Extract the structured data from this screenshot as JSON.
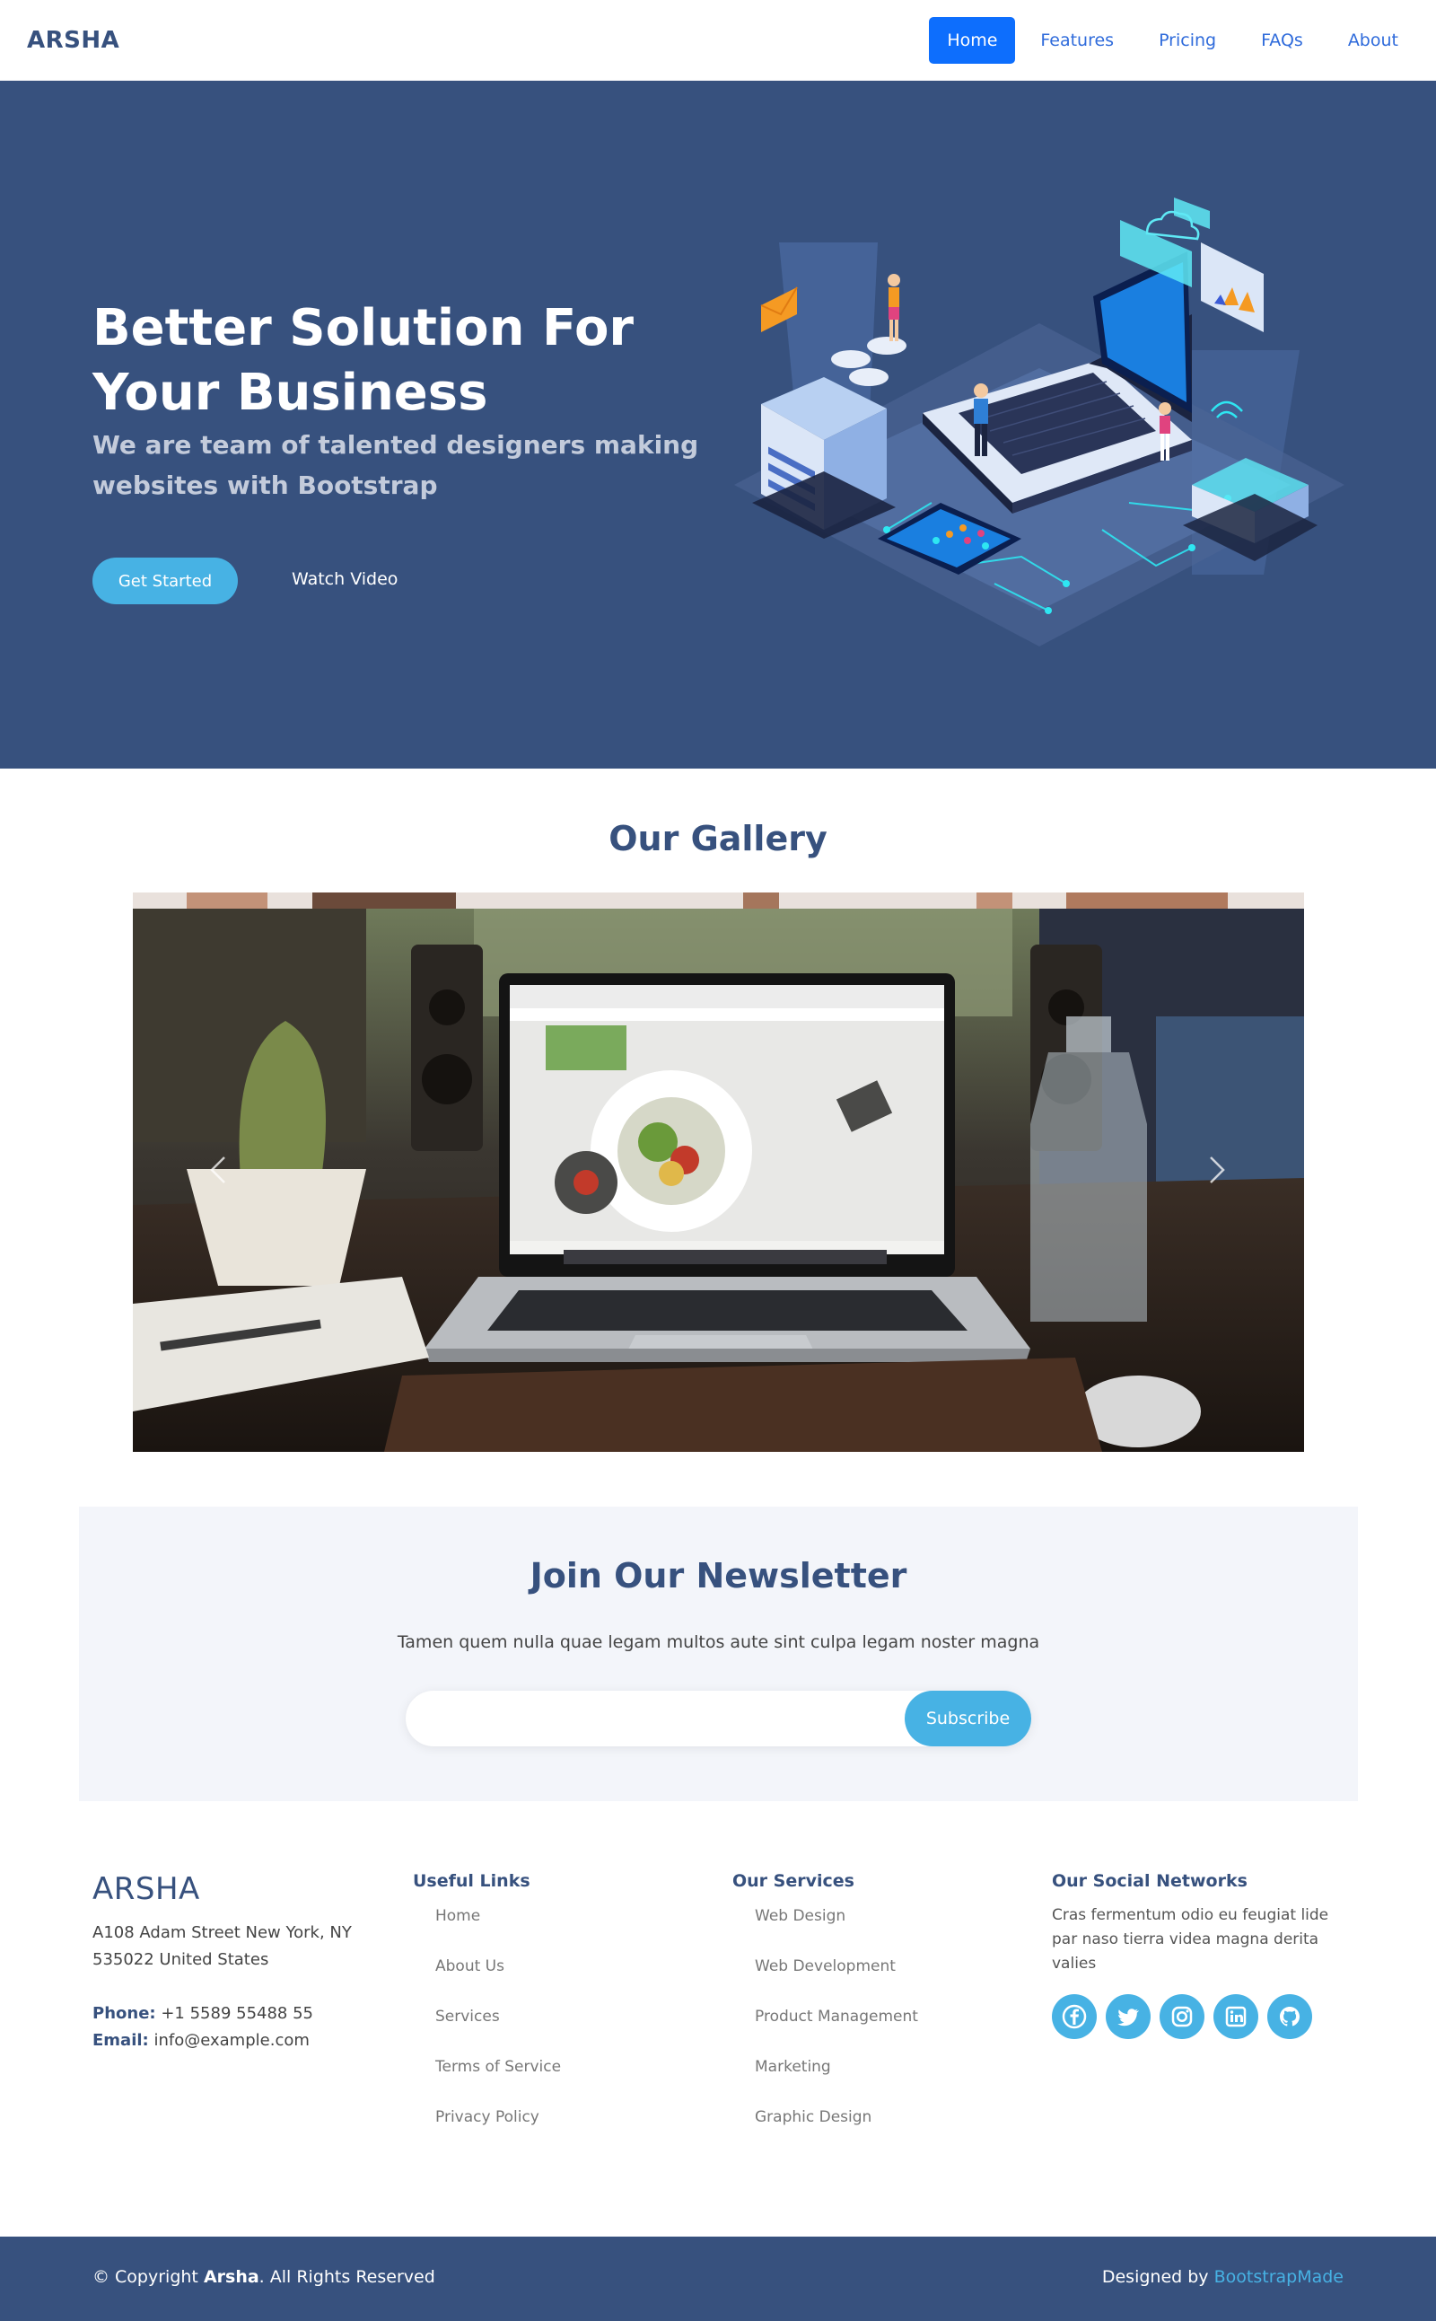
{
  "navbar": {
    "brand": "ARSHA",
    "items": [
      {
        "label": "Home",
        "active": true
      },
      {
        "label": "Features",
        "active": false
      },
      {
        "label": "Pricing",
        "active": false
      },
      {
        "label": "FAQs",
        "active": false
      },
      {
        "label": "About",
        "active": false
      }
    ]
  },
  "hero": {
    "title": "Better Solution For Your Business",
    "subtitle": "We are team of talented designers making websites with Bootstrap",
    "cta_label": "Get Started",
    "video_label": "Watch Video"
  },
  "gallery": {
    "title": "Our Gallery"
  },
  "newsletter": {
    "title": "Join Our Newsletter",
    "text": "Tamen quem nulla quae legam multos aute sint culpa legam noster magna",
    "input_value": "",
    "button_label": "Subscribe"
  },
  "footer": {
    "brand": "ARSHA",
    "address_line1": "A108 Adam Street New York, NY",
    "address_line2": "535022 United States",
    "phone_label": "Phone:",
    "phone": "+1 5589 55488 55",
    "email_label": "Email:",
    "email": "info@example.com",
    "useful_links": {
      "title": "Useful Links",
      "items": [
        "Home",
        "About Us",
        "Services",
        "Terms of Service",
        "Privacy Policy"
      ]
    },
    "services": {
      "title": "Our Services",
      "items": [
        "Web Design",
        "Web Development",
        "Product Management",
        "Marketing",
        "Graphic Design"
      ]
    },
    "social": {
      "title": "Our Social Networks",
      "text": "Cras fermentum odio eu feugiat lide par naso tierra videa magna derita valies",
      "icons": [
        "facebook-icon",
        "twitter-icon",
        "instagram-icon",
        "linkedin-icon",
        "github-icon"
      ]
    },
    "copyright_prefix": "© Copyright",
    "copyright_brand": "Arsha",
    "copyright_suffix": ". All Rights Reserved",
    "credits_prefix": "Designed by",
    "credits_link": "BootstrapMade"
  },
  "colors": {
    "primary": "#37517e",
    "accent": "#47b2e4",
    "nav_active": "#0d6efd",
    "newsletter_bg": "#f3f5fa"
  }
}
